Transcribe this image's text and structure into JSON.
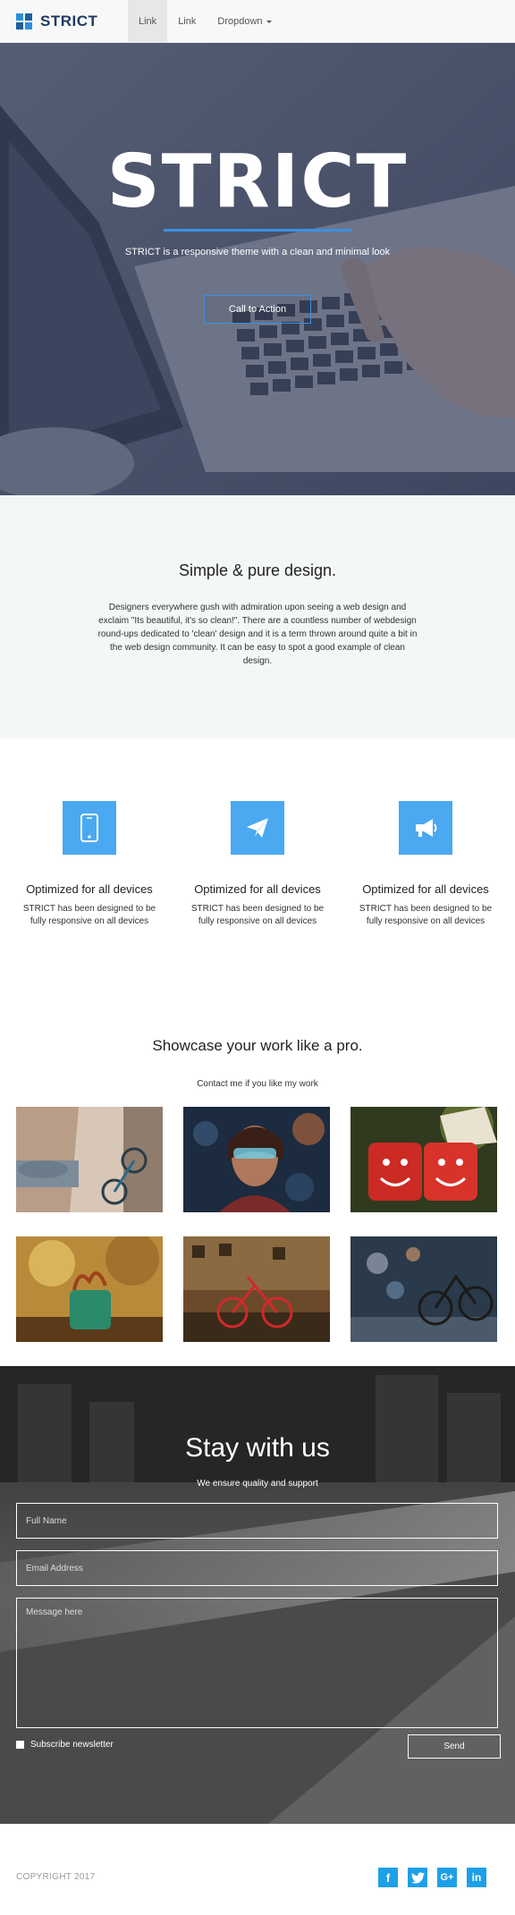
{
  "navbar": {
    "brand": "STRICT",
    "links": [
      "Link",
      "Link",
      "Dropdown"
    ]
  },
  "hero": {
    "title": "STRICT",
    "subtitle": "STRICT is a responsive theme with a clean and minimal look",
    "cta_label": "Call to Action"
  },
  "about": {
    "title": "Simple & pure design.",
    "text": "Designers everywhere gush with admiration upon seeing a web design and exclaim \"Its beautiful, it's so clean!\". There are a countless number of webdesign round-ups dedicated to 'clean' design and it is a term thrown around quite a bit in the web design community. It can be easy to spot a good example of clean design."
  },
  "features": [
    {
      "icon": "mobile-phone-icon",
      "title": "Optimized for all devices",
      "text": "STRICT has been designed to be fully responsive on all devices"
    },
    {
      "icon": "paper-plane-icon",
      "title": "Optimized for all devices",
      "text": "STRICT has been designed to be fully responsive on all devices"
    },
    {
      "icon": "megaphone-icon",
      "title": "Optimized for all devices",
      "text": "STRICT has been designed to be fully responsive on all devices"
    }
  ],
  "showcase": {
    "title": "Showcase your work like a pro.",
    "subtitle": "Contact me if you like my work"
  },
  "contact": {
    "title": "Stay with us",
    "subtitle": "We ensure quality and support",
    "name_placeholder": "Full Name",
    "email_placeholder": "Email Address",
    "message_placeholder": "Message here",
    "newsletter_label": "Subscribe newsletter",
    "send_label": "Send"
  },
  "footer": {
    "copyright": "COPYRIGHT 2017",
    "social": [
      "facebook-icon",
      "twitter-icon",
      "google-plus-icon",
      "linkedin-icon"
    ]
  },
  "colors": {
    "accent": "#4aa9f0",
    "brand": "#1e3a5f",
    "social": "#1ea0e8"
  }
}
